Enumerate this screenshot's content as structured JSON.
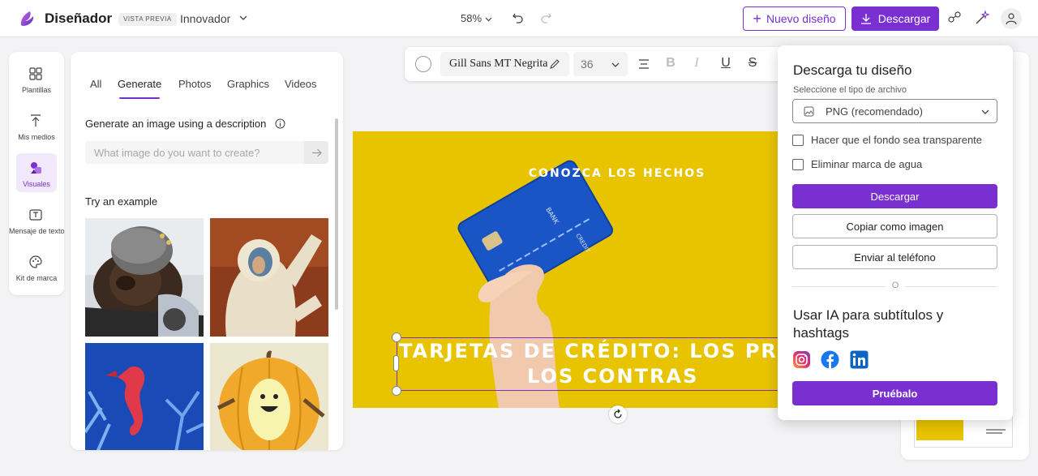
{
  "header": {
    "app_title": "Diseñador",
    "preview_badge": "VISTA PREVIA",
    "plan": "Innovador",
    "zoom": "58%",
    "new_design_label": "Nuevo diseño",
    "download_label": "Descargar"
  },
  "rail": {
    "items": [
      {
        "label": "Plantillas",
        "icon": "templates-icon"
      },
      {
        "label": "Mis medios",
        "icon": "upload-icon"
      },
      {
        "label": "Visuales",
        "icon": "visuals-icon"
      },
      {
        "label": "Mensaje de texto",
        "icon": "text-icon"
      },
      {
        "label": "Kit de marca",
        "icon": "palette-icon"
      }
    ]
  },
  "visuals": {
    "tabs": [
      "All",
      "Generate",
      "Photos",
      "Graphics",
      "Videos"
    ],
    "active_tab": "Generate",
    "generate_title": "Generate an image using a description",
    "prompt_placeholder": "What image do you want to create?",
    "try_title": "Try an example",
    "examples": [
      "bear-helmet-motorcycle",
      "astronaut-painting",
      "paper-seahorse",
      "pumpkin-character"
    ]
  },
  "text_toolbar": {
    "font": "Gill Sans MT Negrita",
    "size": "36",
    "bold": "B",
    "italic": "I",
    "underline": "U",
    "strike": "S"
  },
  "canvas": {
    "kicker": "CONOZCA LOS HECHOS",
    "headline_line1": "TARJETAS DE CRÉDITO: LOS PROS Y",
    "headline_line2": "LOS CONTRAS",
    "card_brand": "BANK",
    "card_type": "CREDIT",
    "background_color": "#e8c300"
  },
  "download_panel": {
    "title": "Descarga tu diseño",
    "file_type_label": "Seleccione el tipo de archivo",
    "file_type_value": "PNG (recomendado)",
    "transparent_bg": "Hacer que el fondo sea transparente",
    "remove_watermark": "Eliminar marca de agua",
    "download_button": "Descargar",
    "copy_button": "Copiar como imagen",
    "send_phone_button": "Enviar al teléfono",
    "or_label": "O",
    "ai_title": "Usar IA para subtítulos y hashtags",
    "try_button": "Pruébalo",
    "socials": [
      "instagram-icon",
      "facebook-icon",
      "linkedin-icon"
    ]
  },
  "colors": {
    "accent": "#7a2fd0",
    "canvas_yellow": "#e8c300"
  }
}
